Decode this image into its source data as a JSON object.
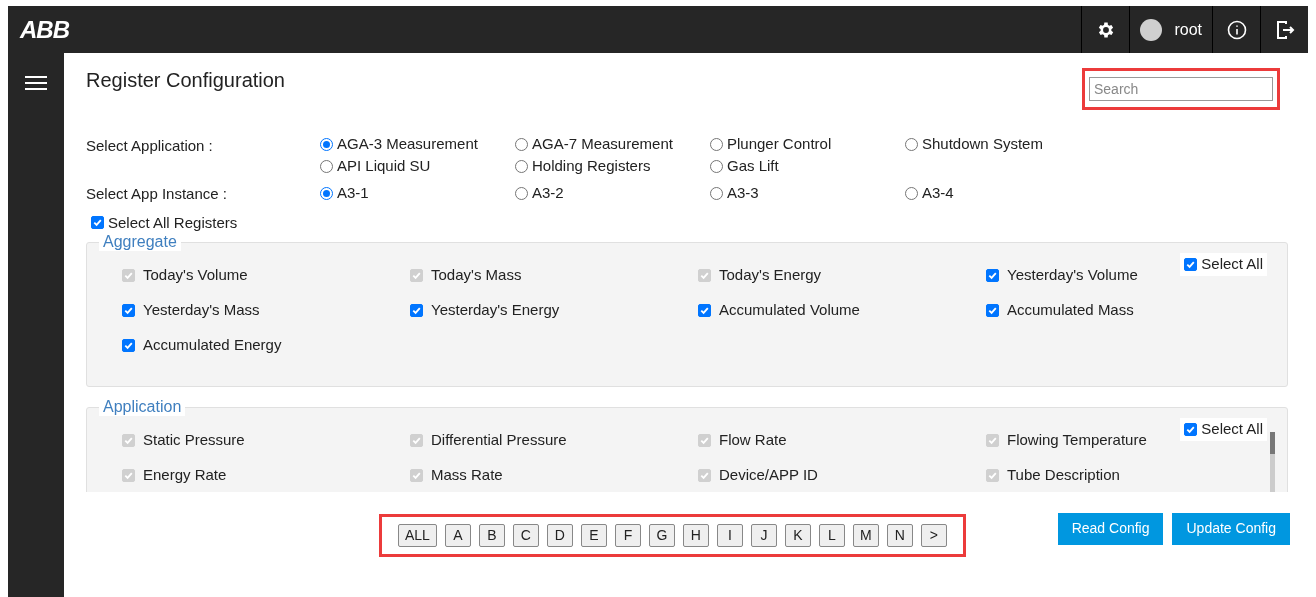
{
  "header": {
    "logo": "ABB",
    "user": "root"
  },
  "page": {
    "title": "Register Configuration",
    "search": {
      "placeholder": "Search"
    }
  },
  "application": {
    "label": "Select Application :",
    "options": [
      {
        "label": "AGA-3 Measurement",
        "selected": true
      },
      {
        "label": "AGA-7 Measurement",
        "selected": false
      },
      {
        "label": "Plunger Control",
        "selected": false
      },
      {
        "label": "Shutdown System",
        "selected": false
      },
      {
        "label": "API Liquid SU",
        "selected": false
      },
      {
        "label": "Holding Registers",
        "selected": false
      },
      {
        "label": "Gas Lift",
        "selected": false
      }
    ]
  },
  "instance": {
    "label": "Select App Instance :",
    "options": [
      {
        "label": "A3-1",
        "selected": true
      },
      {
        "label": "A3-2",
        "selected": false
      },
      {
        "label": "A3-3",
        "selected": false
      },
      {
        "label": "A3-4",
        "selected": false
      }
    ]
  },
  "select_all_registers": {
    "label": "Select All Registers",
    "checked": true
  },
  "groups": [
    {
      "title": "Aggregate",
      "select_all": {
        "label": "Select All",
        "checked": true
      },
      "items": [
        {
          "label": "Today's Volume",
          "checked": true,
          "disabled": true
        },
        {
          "label": "Today's Mass",
          "checked": true,
          "disabled": true
        },
        {
          "label": "Today's Energy",
          "checked": true,
          "disabled": true
        },
        {
          "label": "Yesterday's Volume",
          "checked": true,
          "disabled": false
        },
        {
          "label": "Yesterday's Mass",
          "checked": true,
          "disabled": false
        },
        {
          "label": "Yesterday's Energy",
          "checked": true,
          "disabled": false
        },
        {
          "label": "Accumulated Volume",
          "checked": true,
          "disabled": false
        },
        {
          "label": "Accumulated Mass",
          "checked": true,
          "disabled": false
        },
        {
          "label": "Accumulated Energy",
          "checked": true,
          "disabled": false
        }
      ]
    },
    {
      "title": "Application",
      "select_all": {
        "label": "Select All",
        "checked": true
      },
      "items": [
        {
          "label": "Static Pressure",
          "checked": true,
          "disabled": true
        },
        {
          "label": "Differential Pressure",
          "checked": true,
          "disabled": true
        },
        {
          "label": "Flow Rate",
          "checked": true,
          "disabled": true
        },
        {
          "label": "Flowing Temperature",
          "checked": true,
          "disabled": true
        },
        {
          "label": "Energy Rate",
          "checked": true,
          "disabled": true
        },
        {
          "label": "Mass Rate",
          "checked": true,
          "disabled": true
        },
        {
          "label": "Device/APP ID",
          "checked": true,
          "disabled": true
        },
        {
          "label": "Tube Description",
          "checked": true,
          "disabled": true
        }
      ]
    }
  ],
  "pager": [
    "ALL",
    "A",
    "B",
    "C",
    "D",
    "E",
    "F",
    "G",
    "H",
    "I",
    "J",
    "K",
    "L",
    "M",
    "N",
    ">"
  ],
  "buttons": [
    "Read Config",
    "Update Config"
  ]
}
